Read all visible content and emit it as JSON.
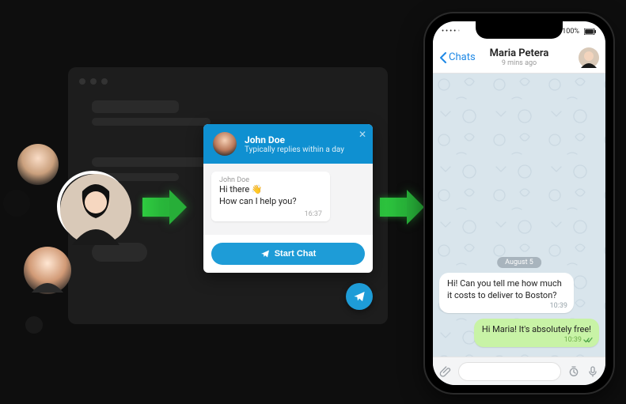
{
  "widget": {
    "agent_name": "John Doe",
    "reply_hint": "Typically replies within a day",
    "bubble_from": "John Doe",
    "bubble_line1": "Hi there 👋",
    "bubble_line2": "How can I help you?",
    "bubble_time": "16:37",
    "start_button": "Start Chat"
  },
  "phone": {
    "status_right": "100%",
    "back_label": "Chats",
    "nav_title": "Maria Petera",
    "nav_subtitle": "9 mins ago",
    "date_label": "August 5",
    "msg_in_text": "Hi! Can you tell me how much it costs to deliver to Boston?",
    "msg_in_time": "10:39",
    "msg_out_text": "Hi Maria! It's absolutely free!",
    "msg_out_time": "10:39"
  }
}
